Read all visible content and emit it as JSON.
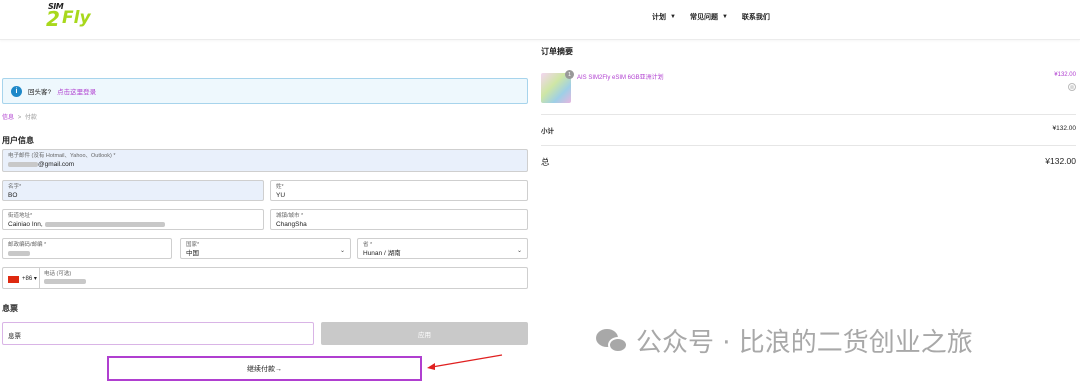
{
  "header": {
    "logo_text_small": "SIM",
    "logo_text_two": "2",
    "logo_text_fly": "Fly",
    "nav": [
      {
        "label": "计划",
        "has_caret": true
      },
      {
        "label": "常见问题",
        "has_caret": true
      },
      {
        "label": "联系我们",
        "has_caret": false
      }
    ]
  },
  "login": {
    "prompt": "回头客?",
    "link": "点击这里登录"
  },
  "breadcrumb": {
    "step1": "信息",
    "sep": ">",
    "step2": "付款"
  },
  "user_info": {
    "title": "用户信息",
    "email_label": "电子邮件 (没有 Hotmail、Yahoo、Outlook) *",
    "email_value": "@gmail.com",
    "first_name_label": "名字*",
    "first_name_value": "BO",
    "last_name_label": "姓*",
    "last_name_value": "YU",
    "street_label": "街道地址*",
    "street_value": "Cainiao Inn,",
    "city_label": "城镇/城市 *",
    "city_value": "ChangSha",
    "postcode_label": "邮政编码/邮编 *",
    "country_label": "国家*",
    "country_value": "中国",
    "province_label": "省 *",
    "province_value": "Hunan / 湖南",
    "phone_code": "+86",
    "phone_label": "电话 (可选)"
  },
  "coupon": {
    "title": "息票",
    "placeholder": "息票",
    "apply_label": "应用"
  },
  "continue_label": "继续付款→",
  "order": {
    "title": "订单摘要",
    "product_qty": "1",
    "product_name": "AIS SIM2Fly eSIM 6GB亚洲计划",
    "product_price": "¥132.00",
    "remove_symbol": "⊗",
    "subtotal_label": "小计",
    "subtotal_value": "¥132.00",
    "total_label": "总",
    "total_value": "¥132.00"
  },
  "watermark": "公众号 · 比浪的二货创业之旅",
  "colors": {
    "accent": "#b03fd0",
    "info_bg": "#eef8fd",
    "info_icon": "#1e88c8",
    "brand_green": "#a8d81c"
  }
}
